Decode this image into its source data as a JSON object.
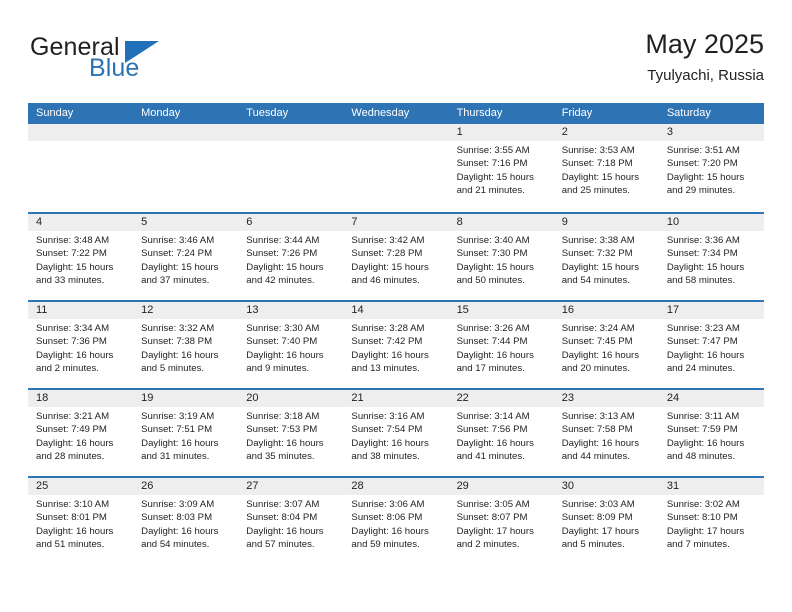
{
  "logo": {
    "text_top": "General",
    "text_bottom": "Blue",
    "triangle_icon": "triangle-icon",
    "brand_color": "#2170b8"
  },
  "header": {
    "title": "May 2025",
    "location": "Tyulyachi, Russia"
  },
  "theme": {
    "header_blue": "#2e74b5",
    "band_gray": "#eeeeee",
    "text": "#231f20"
  },
  "weekday_headers": [
    "Sunday",
    "Monday",
    "Tuesday",
    "Wednesday",
    "Thursday",
    "Friday",
    "Saturday"
  ],
  "weeks": [
    [
      {
        "day": "",
        "sunrise": "",
        "sunset": "",
        "daylight_1": "",
        "daylight_2": ""
      },
      {
        "day": "",
        "sunrise": "",
        "sunset": "",
        "daylight_1": "",
        "daylight_2": ""
      },
      {
        "day": "",
        "sunrise": "",
        "sunset": "",
        "daylight_1": "",
        "daylight_2": ""
      },
      {
        "day": "",
        "sunrise": "",
        "sunset": "",
        "daylight_1": "",
        "daylight_2": ""
      },
      {
        "day": "1",
        "sunrise": "Sunrise: 3:55 AM",
        "sunset": "Sunset: 7:16 PM",
        "daylight_1": "Daylight: 15 hours",
        "daylight_2": "and 21 minutes."
      },
      {
        "day": "2",
        "sunrise": "Sunrise: 3:53 AM",
        "sunset": "Sunset: 7:18 PM",
        "daylight_1": "Daylight: 15 hours",
        "daylight_2": "and 25 minutes."
      },
      {
        "day": "3",
        "sunrise": "Sunrise: 3:51 AM",
        "sunset": "Sunset: 7:20 PM",
        "daylight_1": "Daylight: 15 hours",
        "daylight_2": "and 29 minutes."
      }
    ],
    [
      {
        "day": "4",
        "sunrise": "Sunrise: 3:48 AM",
        "sunset": "Sunset: 7:22 PM",
        "daylight_1": "Daylight: 15 hours",
        "daylight_2": "and 33 minutes."
      },
      {
        "day": "5",
        "sunrise": "Sunrise: 3:46 AM",
        "sunset": "Sunset: 7:24 PM",
        "daylight_1": "Daylight: 15 hours",
        "daylight_2": "and 37 minutes."
      },
      {
        "day": "6",
        "sunrise": "Sunrise: 3:44 AM",
        "sunset": "Sunset: 7:26 PM",
        "daylight_1": "Daylight: 15 hours",
        "daylight_2": "and 42 minutes."
      },
      {
        "day": "7",
        "sunrise": "Sunrise: 3:42 AM",
        "sunset": "Sunset: 7:28 PM",
        "daylight_1": "Daylight: 15 hours",
        "daylight_2": "and 46 minutes."
      },
      {
        "day": "8",
        "sunrise": "Sunrise: 3:40 AM",
        "sunset": "Sunset: 7:30 PM",
        "daylight_1": "Daylight: 15 hours",
        "daylight_2": "and 50 minutes."
      },
      {
        "day": "9",
        "sunrise": "Sunrise: 3:38 AM",
        "sunset": "Sunset: 7:32 PM",
        "daylight_1": "Daylight: 15 hours",
        "daylight_2": "and 54 minutes."
      },
      {
        "day": "10",
        "sunrise": "Sunrise: 3:36 AM",
        "sunset": "Sunset: 7:34 PM",
        "daylight_1": "Daylight: 15 hours",
        "daylight_2": "and 58 minutes."
      }
    ],
    [
      {
        "day": "11",
        "sunrise": "Sunrise: 3:34 AM",
        "sunset": "Sunset: 7:36 PM",
        "daylight_1": "Daylight: 16 hours",
        "daylight_2": "and 2 minutes."
      },
      {
        "day": "12",
        "sunrise": "Sunrise: 3:32 AM",
        "sunset": "Sunset: 7:38 PM",
        "daylight_1": "Daylight: 16 hours",
        "daylight_2": "and 5 minutes."
      },
      {
        "day": "13",
        "sunrise": "Sunrise: 3:30 AM",
        "sunset": "Sunset: 7:40 PM",
        "daylight_1": "Daylight: 16 hours",
        "daylight_2": "and 9 minutes."
      },
      {
        "day": "14",
        "sunrise": "Sunrise: 3:28 AM",
        "sunset": "Sunset: 7:42 PM",
        "daylight_1": "Daylight: 16 hours",
        "daylight_2": "and 13 minutes."
      },
      {
        "day": "15",
        "sunrise": "Sunrise: 3:26 AM",
        "sunset": "Sunset: 7:44 PM",
        "daylight_1": "Daylight: 16 hours",
        "daylight_2": "and 17 minutes."
      },
      {
        "day": "16",
        "sunrise": "Sunrise: 3:24 AM",
        "sunset": "Sunset: 7:45 PM",
        "daylight_1": "Daylight: 16 hours",
        "daylight_2": "and 20 minutes."
      },
      {
        "day": "17",
        "sunrise": "Sunrise: 3:23 AM",
        "sunset": "Sunset: 7:47 PM",
        "daylight_1": "Daylight: 16 hours",
        "daylight_2": "and 24 minutes."
      }
    ],
    [
      {
        "day": "18",
        "sunrise": "Sunrise: 3:21 AM",
        "sunset": "Sunset: 7:49 PM",
        "daylight_1": "Daylight: 16 hours",
        "daylight_2": "and 28 minutes."
      },
      {
        "day": "19",
        "sunrise": "Sunrise: 3:19 AM",
        "sunset": "Sunset: 7:51 PM",
        "daylight_1": "Daylight: 16 hours",
        "daylight_2": "and 31 minutes."
      },
      {
        "day": "20",
        "sunrise": "Sunrise: 3:18 AM",
        "sunset": "Sunset: 7:53 PM",
        "daylight_1": "Daylight: 16 hours",
        "daylight_2": "and 35 minutes."
      },
      {
        "day": "21",
        "sunrise": "Sunrise: 3:16 AM",
        "sunset": "Sunset: 7:54 PM",
        "daylight_1": "Daylight: 16 hours",
        "daylight_2": "and 38 minutes."
      },
      {
        "day": "22",
        "sunrise": "Sunrise: 3:14 AM",
        "sunset": "Sunset: 7:56 PM",
        "daylight_1": "Daylight: 16 hours",
        "daylight_2": "and 41 minutes."
      },
      {
        "day": "23",
        "sunrise": "Sunrise: 3:13 AM",
        "sunset": "Sunset: 7:58 PM",
        "daylight_1": "Daylight: 16 hours",
        "daylight_2": "and 44 minutes."
      },
      {
        "day": "24",
        "sunrise": "Sunrise: 3:11 AM",
        "sunset": "Sunset: 7:59 PM",
        "daylight_1": "Daylight: 16 hours",
        "daylight_2": "and 48 minutes."
      }
    ],
    [
      {
        "day": "25",
        "sunrise": "Sunrise: 3:10 AM",
        "sunset": "Sunset: 8:01 PM",
        "daylight_1": "Daylight: 16 hours",
        "daylight_2": "and 51 minutes."
      },
      {
        "day": "26",
        "sunrise": "Sunrise: 3:09 AM",
        "sunset": "Sunset: 8:03 PM",
        "daylight_1": "Daylight: 16 hours",
        "daylight_2": "and 54 minutes."
      },
      {
        "day": "27",
        "sunrise": "Sunrise: 3:07 AM",
        "sunset": "Sunset: 8:04 PM",
        "daylight_1": "Daylight: 16 hours",
        "daylight_2": "and 57 minutes."
      },
      {
        "day": "28",
        "sunrise": "Sunrise: 3:06 AM",
        "sunset": "Sunset: 8:06 PM",
        "daylight_1": "Daylight: 16 hours",
        "daylight_2": "and 59 minutes."
      },
      {
        "day": "29",
        "sunrise": "Sunrise: 3:05 AM",
        "sunset": "Sunset: 8:07 PM",
        "daylight_1": "Daylight: 17 hours",
        "daylight_2": "and 2 minutes."
      },
      {
        "day": "30",
        "sunrise": "Sunrise: 3:03 AM",
        "sunset": "Sunset: 8:09 PM",
        "daylight_1": "Daylight: 17 hours",
        "daylight_2": "and 5 minutes."
      },
      {
        "day": "31",
        "sunrise": "Sunrise: 3:02 AM",
        "sunset": "Sunset: 8:10 PM",
        "daylight_1": "Daylight: 17 hours",
        "daylight_2": "and 7 minutes."
      }
    ]
  ]
}
